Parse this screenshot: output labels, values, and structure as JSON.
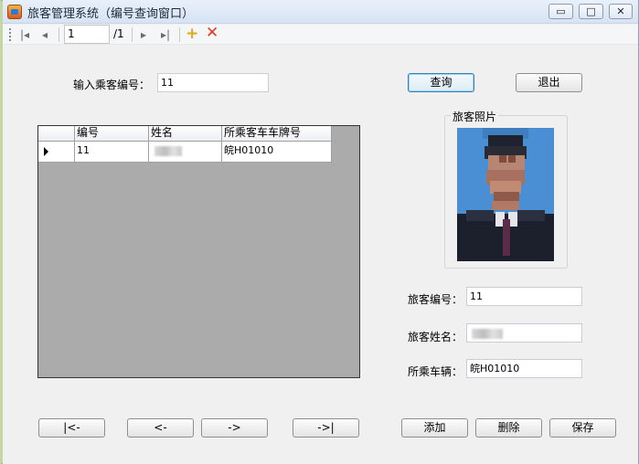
{
  "window": {
    "title": "旅客管理系统（编号查询窗口）",
    "controls": {
      "minimize": "▭",
      "maximize": "□",
      "close": "✕"
    }
  },
  "navigator": {
    "first_icon": "|◂",
    "prev_icon": "◂",
    "position": "1",
    "count": "/1",
    "next_icon": "▸",
    "last_icon": "▸|",
    "add_icon": "+",
    "delete_icon": "✕"
  },
  "search": {
    "label": "输入乘客编号：",
    "value": "11",
    "query_button": "查询",
    "exit_button": "退出"
  },
  "grid": {
    "columns": [
      "编号",
      "姓名",
      "所乘客车车牌号"
    ],
    "rows": [
      {
        "id": "11",
        "name": "",
        "plate": "皖H01010"
      }
    ]
  },
  "photo": {
    "legend": "旅客照片"
  },
  "details": {
    "id_label": "旅客编号：",
    "id_value": "11",
    "name_label": "旅客姓名：",
    "name_value": "",
    "vehicle_label": "所乘车辆：",
    "vehicle_value": "皖H01010"
  },
  "nav_buttons": {
    "first": "|<-",
    "prev": "<-",
    "next": "->",
    "last": "->|"
  },
  "actions": {
    "add": "添加",
    "delete": "删除",
    "save": "保存"
  },
  "colors": {
    "grid_background": "#ababab",
    "photo_background": "#4b8fd3",
    "focus_border": "#3c7fb1"
  }
}
